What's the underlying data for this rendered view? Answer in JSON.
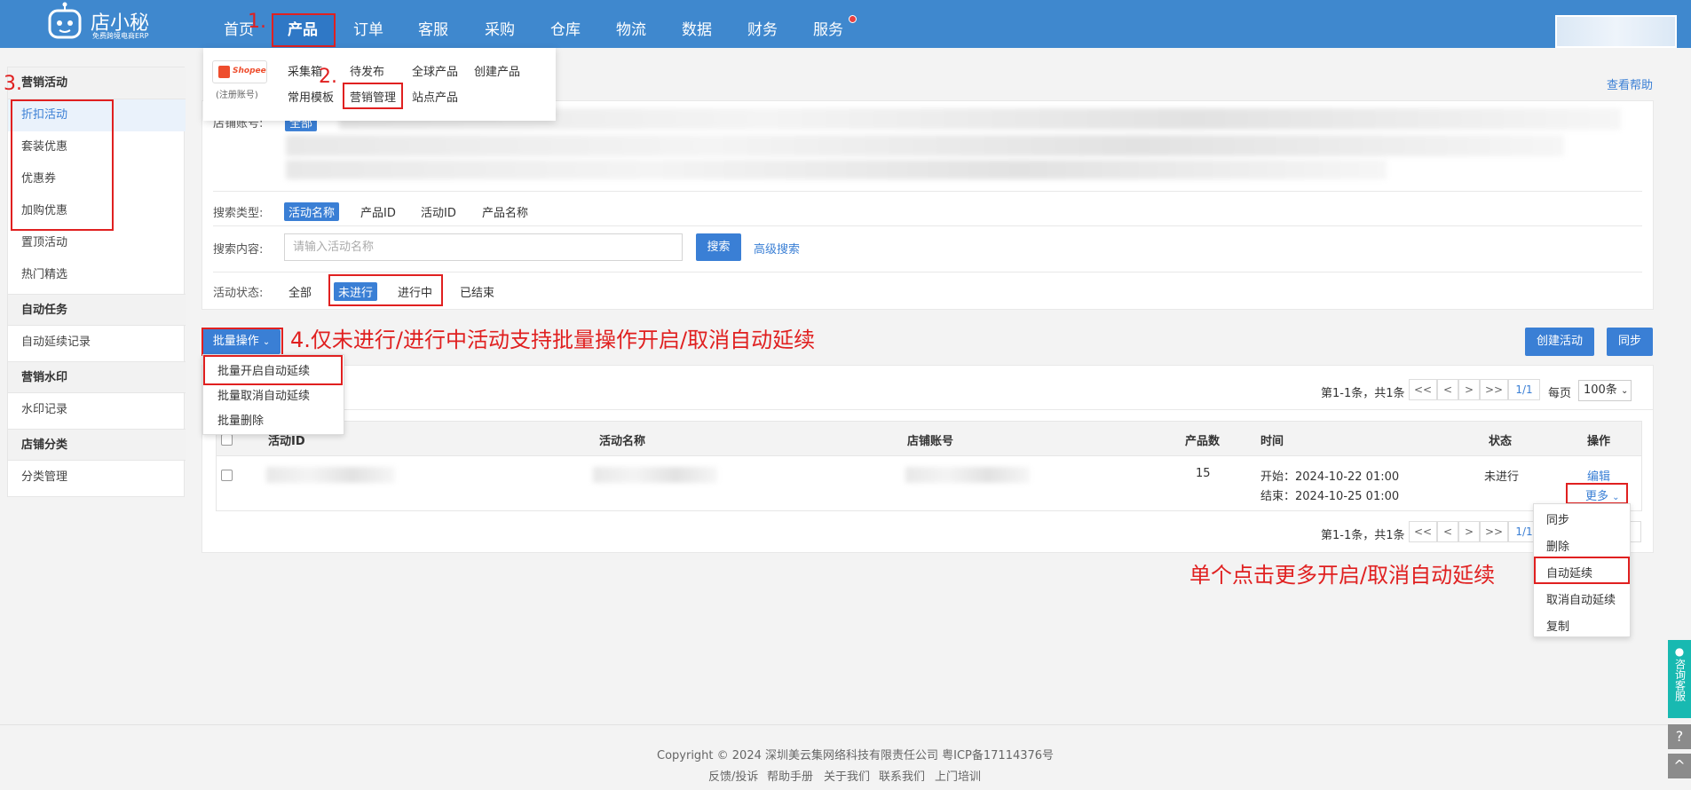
{
  "brand": {
    "name": "店小秘",
    "tagline": "免费跨境电商ERP"
  },
  "nav": [
    {
      "label": "首页"
    },
    {
      "label": "产品"
    },
    {
      "label": "订单"
    },
    {
      "label": "客服"
    },
    {
      "label": "采购"
    },
    {
      "label": "仓库"
    },
    {
      "label": "物流"
    },
    {
      "label": "数据"
    },
    {
      "label": "财务"
    },
    {
      "label": "服务"
    }
  ],
  "product_menu": {
    "shopee_label": "Shopee",
    "register": "(注册账号)",
    "items": [
      "采集箱",
      "待发布",
      "全球产品",
      "创建产品",
      "常用模板",
      "营销管理",
      "站点产品"
    ]
  },
  "sidebar": {
    "groups": [
      {
        "title": "营销活动",
        "items": [
          "折扣活动",
          "套装优惠",
          "优惠券",
          "加购优惠",
          "置顶活动",
          "热门精选"
        ]
      },
      {
        "title": "自动任务",
        "items": [
          "自动延续记录"
        ]
      },
      {
        "title": "营销水印",
        "items": [
          "水印记录"
        ]
      },
      {
        "title": "店铺分类",
        "items": [
          "分类管理"
        ]
      }
    ]
  },
  "help_link": "查看帮助",
  "filters": {
    "account_label": "店铺账号:",
    "account_all": "全部",
    "search_type_label": "搜索类型:",
    "search_types": [
      "活动名称",
      "产品ID",
      "活动ID",
      "产品名称"
    ],
    "search_content_label": "搜索内容:",
    "search_placeholder": "请输入活动名称",
    "search_button": "搜索",
    "advanced_search": "高级搜索",
    "status_label": "活动状态:",
    "statuses": [
      "全部",
      "未进行",
      "进行中",
      "已结束"
    ]
  },
  "toolbar": {
    "batch_button": "批量操作",
    "create_button": "创建活动",
    "sync_button": "同步",
    "batch_menu": [
      "批量开启自动延续",
      "批量取消自动延续",
      "批量删除"
    ]
  },
  "pagination": {
    "summary": "第1-1条，共1条",
    "first": "<<",
    "prev": "<",
    "next": ">",
    "last": ">>",
    "page": "1/1",
    "per_page_label": "每页",
    "per_page": "100条"
  },
  "table": {
    "headers": [
      "活动ID",
      "活动名称",
      "店铺账号",
      "产品数",
      "时间",
      "状态",
      "操作"
    ],
    "row": {
      "product_count": "15",
      "start": "开始：2024-10-22 01:00",
      "end": "结束：2024-10-25 01:00",
      "status": "未进行",
      "edit": "编辑",
      "more": "更多"
    },
    "more_menu": [
      "同步",
      "删除",
      "自动延续",
      "取消自动延续",
      "复制"
    ]
  },
  "annotations": {
    "a1": "1.",
    "a2": "2.",
    "a3": "3.",
    "a4": "4.仅未进行/进行中活动支持批量操作开启/取消自动延续",
    "a5": "单个点击更多开启/取消自动延续"
  },
  "footer": {
    "copyright": "Copyright © 2024 深圳美云集网络科技有限责任公司  粤ICP备17114376号",
    "links": [
      "反馈/投诉",
      "帮助手册",
      "关于我们",
      "联系我们",
      "上门培训"
    ]
  },
  "float": {
    "consult": "咨询客服",
    "help": "?",
    "top": "^"
  }
}
